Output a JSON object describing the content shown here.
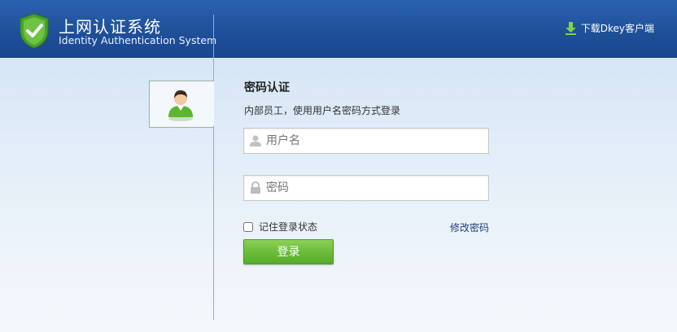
{
  "header": {
    "title_cn": "上网认证系统",
    "title_en": "Identity Authentication System",
    "download_label": "下载Dkey客户端"
  },
  "form": {
    "title": "密码认证",
    "subtitle": "内部员工，使用用户名密码方式登录",
    "username_placeholder": "用户名",
    "password_placeholder": "密码",
    "remember_label": "记住登录状态",
    "remember_checked": false,
    "change_password_label": "修改密码",
    "login_label": "登录"
  },
  "icons": {
    "logo": "shield-check-icon",
    "download": "download-arrow-icon",
    "avatar": "user-avatar-icon",
    "username": "user-icon",
    "password": "lock-icon"
  },
  "colors": {
    "header_blue": "#1e4f98",
    "login_green": "#6bbd3a",
    "link_blue": "#1a3e78",
    "shield_green": "#5cb531"
  }
}
